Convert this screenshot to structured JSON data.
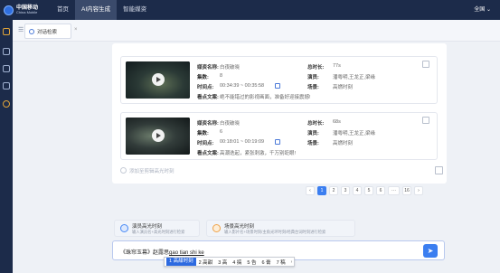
{
  "brand": {
    "cn": "中国移动",
    "en": "China Mobile"
  },
  "nav": [
    {
      "label": "首页"
    },
    {
      "label": "AI内容生成"
    },
    {
      "label": "智能媒资"
    }
  ],
  "top_right": "全国 ⌄",
  "tab": {
    "label": "对话检索",
    "close": "×"
  },
  "cards": [
    {
      "title_label": "媒资名称:",
      "title": "白夜破晓",
      "episode_label": "集数:",
      "episode": "8",
      "time_label": "时间点:",
      "time": "00:34:39 ~ 00:35:58",
      "highlight_label": "看点文案:",
      "highlight": "绝不能错过的影视画面，准备好迎接震撼!",
      "duration_label": "总时长:",
      "duration": "77s",
      "actors_label": "演员:",
      "actors": "潘粤明,王龙正,梁缘",
      "scene_label": "场景:",
      "scene": "高燃时刻"
    },
    {
      "title_label": "媒资名称:",
      "title": "白夜破晓",
      "episode_label": "集数:",
      "episode": "6",
      "time_label": "时间点:",
      "time": "00:18:01 ~ 00:19:09",
      "highlight_label": "看点文案:",
      "highlight": "高潮迭起，紧张刺激，千万别眨眼!",
      "duration_label": "总时长:",
      "duration": "68s",
      "actors_label": "演员:",
      "actors": "潘粤明,王龙正,梁缘",
      "scene_label": "场景:",
      "scene": "高燃时刻"
    }
  ],
  "add_clip": "添加至剪辑高光时刻",
  "pagination": [
    "‹",
    "1",
    "2",
    "3",
    "4",
    "5",
    "6",
    "···",
    "16",
    "›"
  ],
  "suggestions": [
    {
      "title": "演员高光时刻",
      "desc": "输入演员名+高光时刻进行检索",
      "icon": "star-icon",
      "color": "#4a8af5"
    },
    {
      "title": "场景高光时刻",
      "desc": "输入影片名+场景时刻/主角光环时刻/经典台词时刻进行检索",
      "icon": "moon-icon",
      "color": "#f0a34a"
    }
  ],
  "input": {
    "prefix": "《珠帘玉幕》赵露思",
    "composing": "gao tian shi ke"
  },
  "ime_candidates": [
    {
      "label": "1 高甜时刻",
      "selected": true
    },
    {
      "label": "2 高甜"
    },
    {
      "label": "3 高"
    },
    {
      "label": "4 搞"
    },
    {
      "label": "5 告"
    },
    {
      "label": "6 膏"
    },
    {
      "label": "7 稿"
    }
  ],
  "ime_next": "›",
  "send_icon": "paper-plane-icon",
  "colors": {
    "topbar": "#1c2b4a",
    "accent": "#3b7ef0"
  }
}
